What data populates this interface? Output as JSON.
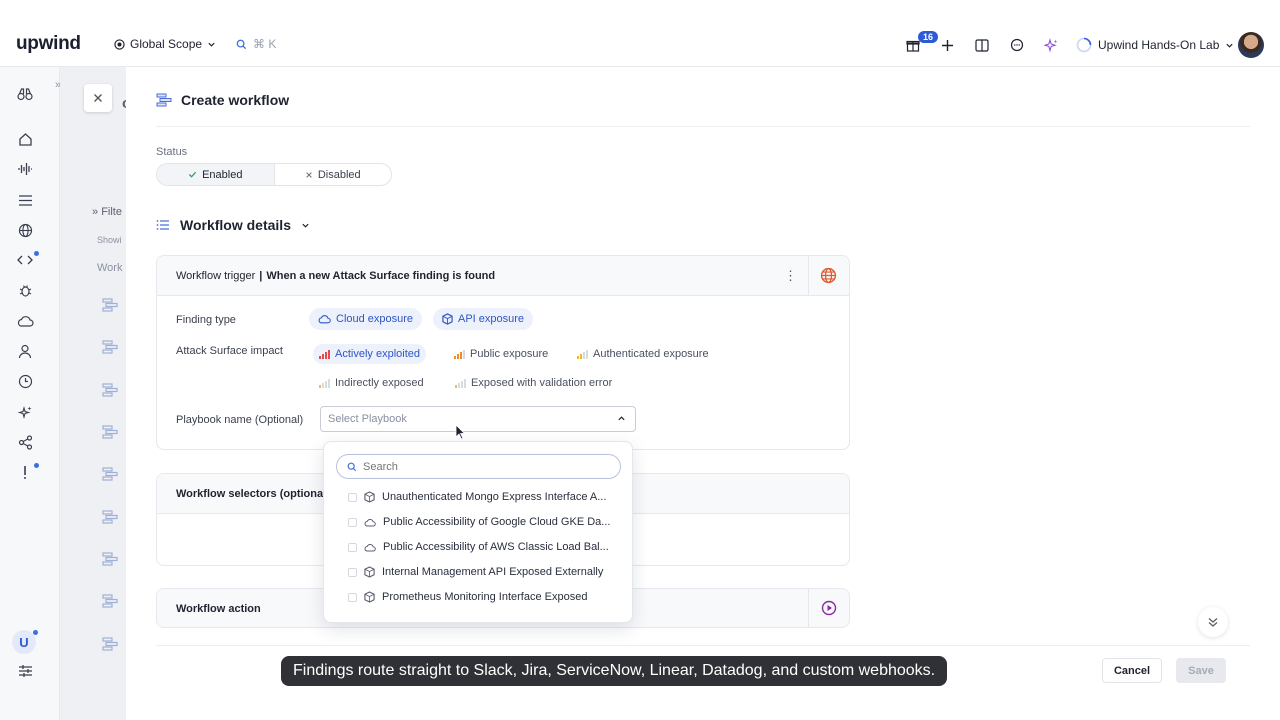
{
  "brand": "upwind",
  "header": {
    "scope_label": "Global Scope",
    "search_hint": "⌘ K",
    "gift_badge": "16",
    "org_name": "Upwind Hands-On Lab"
  },
  "background_page": {
    "title_fragment": "on",
    "filter_label": "Filte",
    "showing_label": "Showi",
    "column_label": "Work"
  },
  "drawer": {
    "title": "Create workflow",
    "status_label": "Status",
    "status_enabled": "Enabled",
    "status_disabled": "Disabled",
    "details_heading": "Workflow details",
    "trigger_prefix": "Workflow trigger",
    "trigger_text": "When a new Attack Surface finding is found",
    "finding_type_label": "Finding type",
    "finding_types": [
      "Cloud exposure",
      "API exposure"
    ],
    "impact_label": "Attack Surface impact",
    "impacts": [
      "Actively exploited",
      "Public exposure",
      "Authenticated exposure",
      "Indirectly exposed",
      "Exposed with validation error"
    ],
    "playbook_label": "Playbook name (Optional)",
    "playbook_placeholder": "Select Playbook",
    "selectors_title": "Workflow selectors (optional)",
    "action_title": "Workflow action",
    "cancel_label": "Cancel",
    "save_label": "Save"
  },
  "dropdown": {
    "search_placeholder": "Search",
    "items": [
      "Unauthenticated Mongo Express Interface A...",
      "Public Accessibility of Google Cloud GKE Da...",
      "Public Accessibility of AWS Classic Load Bal...",
      "Internal Management API Exposed Externally",
      "Prometheus Monitoring Interface Exposed"
    ]
  },
  "caption": "Findings route straight to Slack, Jira, ServiceNow, Linear, Datadog, and custom webhooks.",
  "colors": {
    "accent": "#2f55c7",
    "chip_bg": "#edf1fb",
    "danger": "#e5484d",
    "warning": "#f08c2e",
    "caption_bg": "#2f3136"
  }
}
